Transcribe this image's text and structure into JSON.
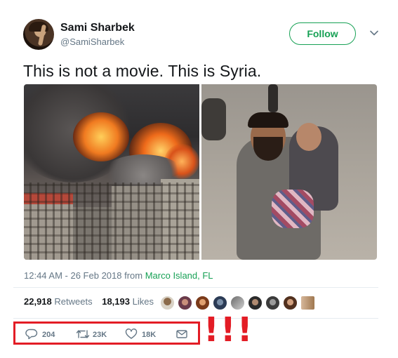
{
  "user": {
    "display_name": "Sami Sharbek",
    "handle": "@SamiSharbek"
  },
  "follow_label": "Follow",
  "tweet_text": "This is not a movie. This is Syria.",
  "meta": {
    "time": "12:44 AM - 26 Feb 2018 from ",
    "location": "Marco Island, FL"
  },
  "stats": {
    "retweets_count": "22,918",
    "retweets_label": "Retweets",
    "likes_count": "18,193",
    "likes_label": "Likes"
  },
  "actions": {
    "reply_count": "204",
    "retweet_count": "23K",
    "like_count": "18K"
  },
  "annotation": "!!!",
  "colors": {
    "accent_green": "#17a155",
    "highlight_red": "#e31c25",
    "secondary_text": "#657786"
  },
  "icons": [
    "chevron-down-icon",
    "reply-icon",
    "retweet-icon",
    "heart-icon",
    "mail-icon"
  ]
}
